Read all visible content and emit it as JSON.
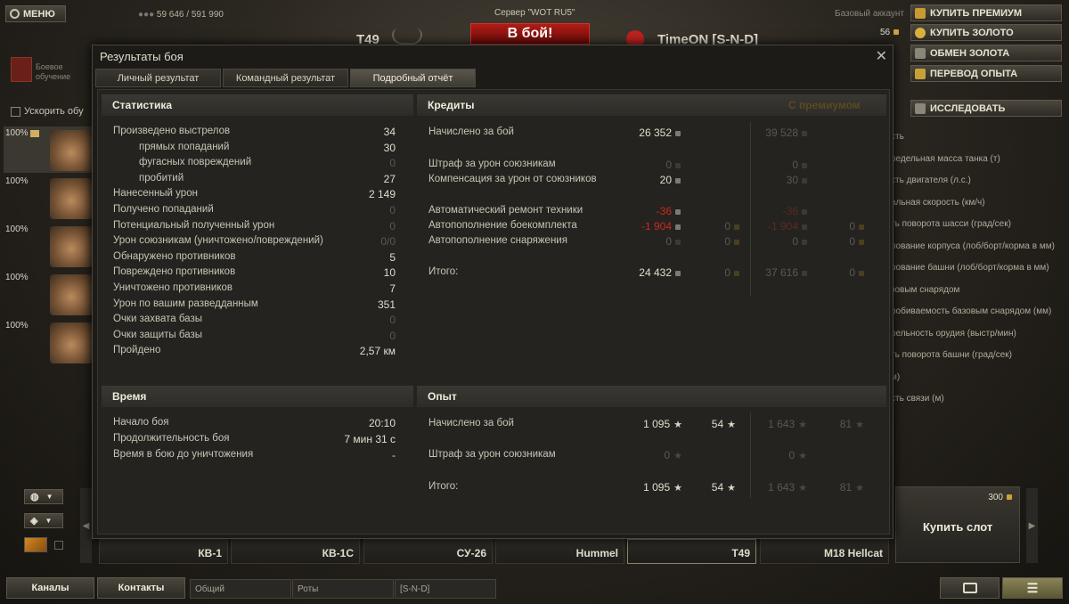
{
  "top": {
    "menu": "МЕНЮ",
    "credits": "59 646 / 591 990",
    "server": "Сервер \"WOT RU5\"",
    "tank": "T49",
    "battle": "В бой!",
    "player": "TimeON [S-N-D]",
    "account": "Базовый аккаунт",
    "gold": "56",
    "buttons": [
      "КУПИТЬ ПРЕМИУМ",
      "КУПИТЬ ЗОЛОТО",
      "ОБМЕН ЗОЛОТА",
      "ПЕРЕВОД ОПЫТА",
      "ИССЛЕДОВАТЬ"
    ]
  },
  "left": {
    "training": "Боевое обучение",
    "speedup": "Ускорить обу",
    "crew": [
      "100%",
      "100%",
      "100%",
      "100%",
      "100%"
    ]
  },
  "right_list": [
    "сть",
    "редельная масса танка (т)",
    "сть двигателя (л.с.)",
    "альная скорость (км/ч)",
    "ть поворота шасси (град/сек)",
    "рование корпуса (лоб/борт/корма в мм)",
    "рование башни (лоб/борт/корма в мм)",
    "зовым снарядом",
    "робиваемость базовым снарядом (мм)",
    "рельность орудия (выстр/мин)",
    "ть поворота башни (град/сек)",
    "м)",
    "сть связи (м)"
  ],
  "dialog": {
    "title": "Результаты боя",
    "tabs": [
      "Личный результат",
      "Командный результат",
      "Подробный отчёт"
    ],
    "stats": {
      "header": "Статистика",
      "rows": [
        {
          "label": "Произведено выстрелов",
          "value": "34",
          "indent": false,
          "dim": false
        },
        {
          "label": "прямых попаданий",
          "value": "30",
          "indent": true,
          "dim": false
        },
        {
          "label": "фугасных повреждений",
          "value": "0",
          "indent": true,
          "dim": true
        },
        {
          "label": "пробитий",
          "value": "27",
          "indent": true,
          "dim": false
        },
        {
          "label": "Нанесенный урон",
          "value": "2 149",
          "indent": false,
          "dim": false
        },
        {
          "label": "Получено попаданий",
          "value": "0",
          "indent": false,
          "dim": true
        },
        {
          "label": "Потенциальный полученный урон",
          "value": "0",
          "indent": false,
          "dim": true
        },
        {
          "label": "Урон союзникам (уничтожено/повреждений)",
          "value": "0/0",
          "indent": false,
          "dim": true
        },
        {
          "label": "Обнаружено противников",
          "value": "5",
          "indent": false,
          "dim": false
        },
        {
          "label": "Повреждено противников",
          "value": "10",
          "indent": false,
          "dim": false
        },
        {
          "label": "Уничтожено противников",
          "value": "7",
          "indent": false,
          "dim": false
        },
        {
          "label": "Урон по вашим разведданным",
          "value": "351",
          "indent": false,
          "dim": false
        },
        {
          "label": "Очки захвата базы",
          "value": "0",
          "indent": false,
          "dim": true
        },
        {
          "label": "Очки защиты базы",
          "value": "0",
          "indent": false,
          "dim": true
        },
        {
          "label": "Пройдено",
          "value": "2,57 км",
          "indent": false,
          "dim": false
        }
      ]
    },
    "time": {
      "header": "Время",
      "rows": [
        {
          "label": "Начало боя",
          "value": "20:10"
        },
        {
          "label": "Продолжительность боя",
          "value": "7 мин 31 с"
        },
        {
          "label": "Время в бою до уничтожения",
          "value": "-"
        }
      ]
    },
    "credits": {
      "header": "Кредиты",
      "premium_header": "С премиумом",
      "rows": [
        {
          "label": "Начислено за бой",
          "c": "26 352",
          "g": "",
          "pc": "39 528",
          "pg": ""
        },
        {
          "label": "Штраф за урон союзникам",
          "c": "0",
          "g": "",
          "pc": "0",
          "pg": ""
        },
        {
          "label": "Компенсация за урон от союзников",
          "c": "20",
          "g": "",
          "pc": "30",
          "pg": ""
        },
        {
          "label": "Автоматический ремонт техники",
          "c": "-36",
          "g": "",
          "pc": "-36",
          "pg": ""
        },
        {
          "label": "Автопополнение боекомплекта",
          "c": "-1 904",
          "g": "0",
          "pc": "-1 904",
          "pg": "0"
        },
        {
          "label": "Автопополнение снаряжения",
          "c": "0",
          "g": "0",
          "pc": "0",
          "pg": "0"
        },
        {
          "label": "Итого:",
          "c": "24 432",
          "g": "0",
          "pc": "37 616",
          "pg": "0"
        }
      ]
    },
    "exp": {
      "header": "Опыт",
      "rows": [
        {
          "label": "Начислено за бой",
          "e": "1 095",
          "f": "54",
          "pe": "1 643",
          "pf": "81"
        },
        {
          "label": "Штраф за урон союзникам",
          "e": "0",
          "f": "",
          "pe": "0",
          "pf": ""
        },
        {
          "label": "Итого:",
          "e": "1 095",
          "f": "54",
          "pe": "1 643",
          "pf": "81"
        }
      ]
    }
  },
  "tanks": [
    "КВ-1",
    "КВ-1С",
    "СУ-26",
    "Hummel",
    "T49",
    "M18 Hellcat"
  ],
  "buy_slot": {
    "label": "Купить слот",
    "price": "300"
  },
  "bottom": {
    "channels": "Каналы",
    "contacts": "Контакты",
    "chat": [
      "Общий",
      "Роты",
      "[S-N-D]"
    ]
  }
}
